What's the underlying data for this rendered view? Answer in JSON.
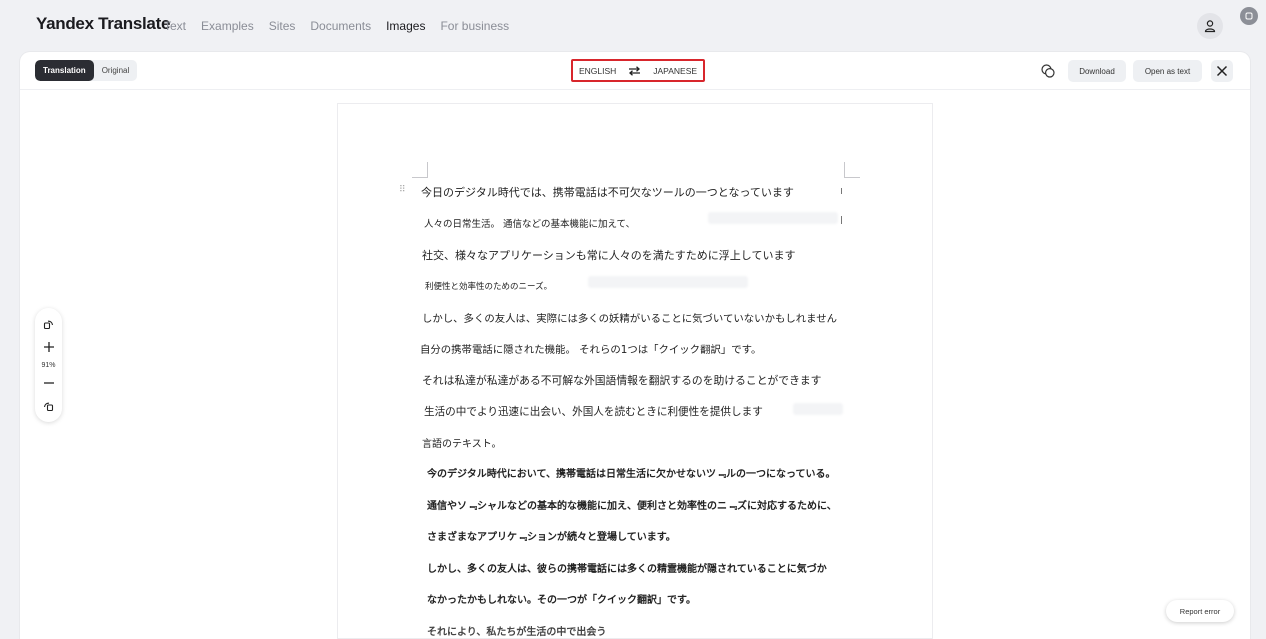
{
  "app": {
    "brand": "Yandex Translate"
  },
  "nav": {
    "items": [
      {
        "label": "Text",
        "active": false
      },
      {
        "label": "Examples",
        "active": false
      },
      {
        "label": "Sites",
        "active": false
      },
      {
        "label": "Documents",
        "active": false
      },
      {
        "label": "Images",
        "active": true
      },
      {
        "label": "For business",
        "active": false
      }
    ]
  },
  "toolbar": {
    "view_toggle": {
      "translation": "Translation",
      "original": "Original",
      "selected": "Translation"
    },
    "source_lang": "ENGLISH",
    "target_lang": "JAPANESE",
    "download_label": "Download",
    "open_as_text_label": "Open as text"
  },
  "icons": {
    "swap": "swap-arrows-icon",
    "chat": "chat-bubbles-icon",
    "close": "close-icon",
    "user": "user-icon",
    "rotate_left": "rotate-left-icon",
    "zoom_in": "plus-icon",
    "zoom_out": "minus-icon",
    "rotate_right": "rotate-right-icon"
  },
  "zoom": {
    "level": "91%"
  },
  "document": {
    "lines": [
      "今日のデジタル時代では、携帯電話は不可欠なツールの一つとなっています",
      "人々の日常生活。 通信などの基本機能に加えて、",
      "社交、様々なアプリケーションも常に人々のを満たすために浮上しています",
      "利便性と効率性のためのニーズ。",
      "しかし、多くの友人は、実際には多くの妖精がいることに気づいていないかもしれません",
      "自分の携帯電話に隠された機能。 それらの1つは「クイック翻訳」です。",
      "それは私達が私達がある不可解な外国語情報を翻訳するのを助けることができます",
      "生活の中でより迅速に出会い、外国人を読むときに利便性を提供します",
      "言語のテキスト。"
    ],
    "bold_lines": [
      "今のデジタル時代において、携帯電話は日常生活に欠かせないツ﹃ルの一つになっている。",
      "通信やソ﹃シャルなどの基本的な機能に加え、便利さと効率性のニ﹃ズに対応するために、",
      "さまざまなアプリケ﹃ションが続々と登場しています。",
      "しかし、多くの友人は、彼らの携帯電話には多くの精霊機能が隠されていることに気づか",
      "なかったかもしれない。その一つが「クイック翻訳」です。"
    ]
  },
  "footer": {
    "report_error": "Report error"
  },
  "colors": {
    "highlight_box": "#d8262c",
    "toggle_active": "#2b2d33"
  }
}
